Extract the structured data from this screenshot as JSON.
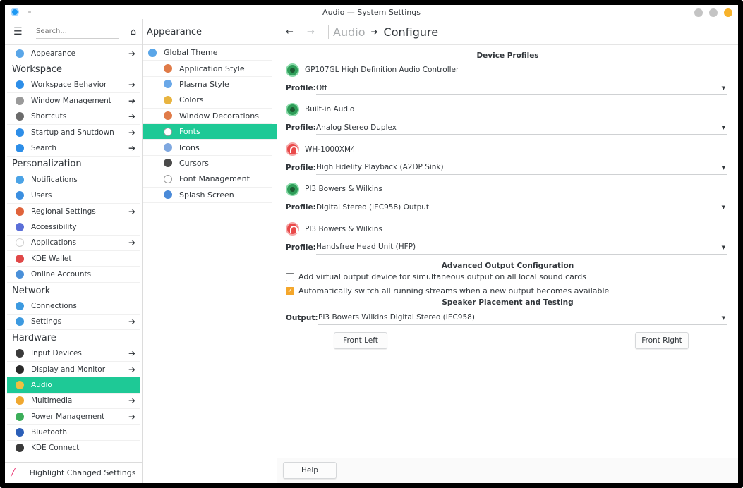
{
  "window": {
    "title": "Audio — System Settings",
    "buttons": [
      {
        "name": "minimize",
        "color": "#c4c4c4"
      },
      {
        "name": "maximize",
        "color": "#c4c4c4"
      },
      {
        "name": "close",
        "color": "#f7b22b"
      }
    ]
  },
  "sidebar": {
    "search_placeholder": "Search...",
    "entries": [
      {
        "kind": "item",
        "label": "Appearance",
        "icon": "appearance-icon",
        "color": "#5aa6e8",
        "arrow": true
      },
      {
        "kind": "cat",
        "label": "Workspace"
      },
      {
        "kind": "item",
        "label": "Workspace Behavior",
        "icon": "workspace-behavior-icon",
        "color": "#2d8ee8",
        "arrow": true
      },
      {
        "kind": "item",
        "label": "Window Management",
        "icon": "window-management-icon",
        "color": "#9a9a9a",
        "arrow": true
      },
      {
        "kind": "item",
        "label": "Shortcuts",
        "icon": "keyboard-icon",
        "color": "#6b6b6b",
        "arrow": true
      },
      {
        "kind": "item",
        "label": "Startup and Shutdown",
        "icon": "startup-icon",
        "color": "#2d8ee8",
        "arrow": true
      },
      {
        "kind": "item",
        "label": "Search",
        "icon": "search-icon",
        "color": "#2d8ee8",
        "arrow": true
      },
      {
        "kind": "cat",
        "label": "Personalization"
      },
      {
        "kind": "item",
        "label": "Notifications",
        "icon": "notifications-icon",
        "color": "#4ba3e6",
        "arrow": false
      },
      {
        "kind": "item",
        "label": "Users",
        "icon": "users-icon",
        "color": "#3b8fe0",
        "arrow": false
      },
      {
        "kind": "item",
        "label": "Regional Settings",
        "icon": "regional-icon",
        "color": "#e0633b",
        "arrow": true
      },
      {
        "kind": "item",
        "label": "Accessibility",
        "icon": "accessibility-icon",
        "color": "#5b6fd8",
        "arrow": false
      },
      {
        "kind": "item",
        "label": "Applications",
        "icon": "applications-icon",
        "color": "#ffffff",
        "arrow": true
      },
      {
        "kind": "item",
        "label": "KDE Wallet",
        "icon": "wallet-icon",
        "color": "#e04848",
        "arrow": false
      },
      {
        "kind": "item",
        "label": "Online Accounts",
        "icon": "online-accounts-icon",
        "color": "#4a90d9",
        "arrow": false
      },
      {
        "kind": "cat",
        "label": "Network"
      },
      {
        "kind": "item",
        "label": "Connections",
        "icon": "connections-icon",
        "color": "#3d9ae0",
        "arrow": false
      },
      {
        "kind": "item",
        "label": "Settings",
        "icon": "network-settings-icon",
        "color": "#3d9ae0",
        "arrow": true
      },
      {
        "kind": "cat",
        "label": "Hardware"
      },
      {
        "kind": "item",
        "label": "Input Devices",
        "icon": "input-devices-icon",
        "color": "#3a3a3a",
        "arrow": true
      },
      {
        "kind": "item",
        "label": "Display and Monitor",
        "icon": "display-icon",
        "color": "#2a2a2a",
        "arrow": true
      },
      {
        "kind": "item",
        "label": "Audio",
        "icon": "audio-icon",
        "color": "#f0c040",
        "arrow": false,
        "selected": true
      },
      {
        "kind": "item",
        "label": "Multimedia",
        "icon": "multimedia-icon",
        "color": "#f0a830",
        "arrow": true
      },
      {
        "kind": "item",
        "label": "Power Management",
        "icon": "power-icon",
        "color": "#3cae5a",
        "arrow": true
      },
      {
        "kind": "item",
        "label": "Bluetooth",
        "icon": "bluetooth-icon",
        "color": "#2b5fb8",
        "arrow": false
      },
      {
        "kind": "item",
        "label": "KDE Connect",
        "icon": "kde-connect-icon",
        "color": "#3a3a3a",
        "arrow": false
      }
    ],
    "footer_label": "Highlight Changed Settings"
  },
  "middle": {
    "title": "Appearance",
    "items": [
      {
        "label": "Global Theme",
        "icon": "global-theme-icon",
        "color": "#5aa6e8",
        "level": "root"
      },
      {
        "label": "Application Style",
        "icon": "application-style-icon",
        "color": "#e07b48",
        "level": "child"
      },
      {
        "label": "Plasma Style",
        "icon": "plasma-style-icon",
        "color": "#6aa8e8",
        "level": "child"
      },
      {
        "label": "Colors",
        "icon": "colors-icon",
        "color": "#e8b440",
        "level": "child"
      },
      {
        "label": "Window Decorations",
        "icon": "window-decorations-icon",
        "color": "#e07b48",
        "level": "child"
      },
      {
        "label": "Fonts",
        "icon": "fonts-icon",
        "color": "#ffffff",
        "level": "child",
        "selected": true
      },
      {
        "label": "Icons",
        "icon": "icons-icon",
        "color": "#7fa8e0",
        "level": "child"
      },
      {
        "label": "Cursors",
        "icon": "cursors-icon",
        "color": "#4a4a4a",
        "level": "child"
      },
      {
        "label": "Font Management",
        "icon": "font-management-icon",
        "color": "#ffffff",
        "level": "child"
      },
      {
        "label": "Splash Screen",
        "icon": "splash-screen-icon",
        "color": "#4a8ad8",
        "level": "child"
      }
    ]
  },
  "main": {
    "breadcrumb_parent": "Audio",
    "breadcrumb_current": "Configure",
    "device_profiles_title": "Device Profiles",
    "profile_label": "Profile:",
    "devices": [
      {
        "name": "GP107GL High Definition Audio Controller",
        "icon": "speaker",
        "profile": "Off"
      },
      {
        "name": "Built-in Audio",
        "icon": "speaker",
        "profile": "Analog Stereo Duplex"
      },
      {
        "name": "WH-1000XM4",
        "icon": "headphone",
        "profile": "High Fidelity Playback (A2DP Sink)"
      },
      {
        "name": "PI3 Bowers & Wilkins",
        "icon": "speaker",
        "profile": "Digital Stereo (IEC958) Output"
      },
      {
        "name": "PI3 Bowers & Wilkins",
        "icon": "headphone",
        "profile": "Handsfree Head Unit (HFP)"
      }
    ],
    "advanced_title": "Advanced Output Configuration",
    "checkboxes": [
      {
        "label": "Add virtual output device for simultaneous output on all local sound cards",
        "checked": false
      },
      {
        "label": "Automatically switch all running streams when a new output becomes available",
        "checked": true
      }
    ],
    "speaker_title": "Speaker Placement and Testing",
    "output_label": "Output:",
    "output_value": "PI3 Bowers  Wilkins Digital Stereo (IEC958)",
    "front_left": "Front Left",
    "front_right": "Front Right",
    "help": "Help"
  }
}
